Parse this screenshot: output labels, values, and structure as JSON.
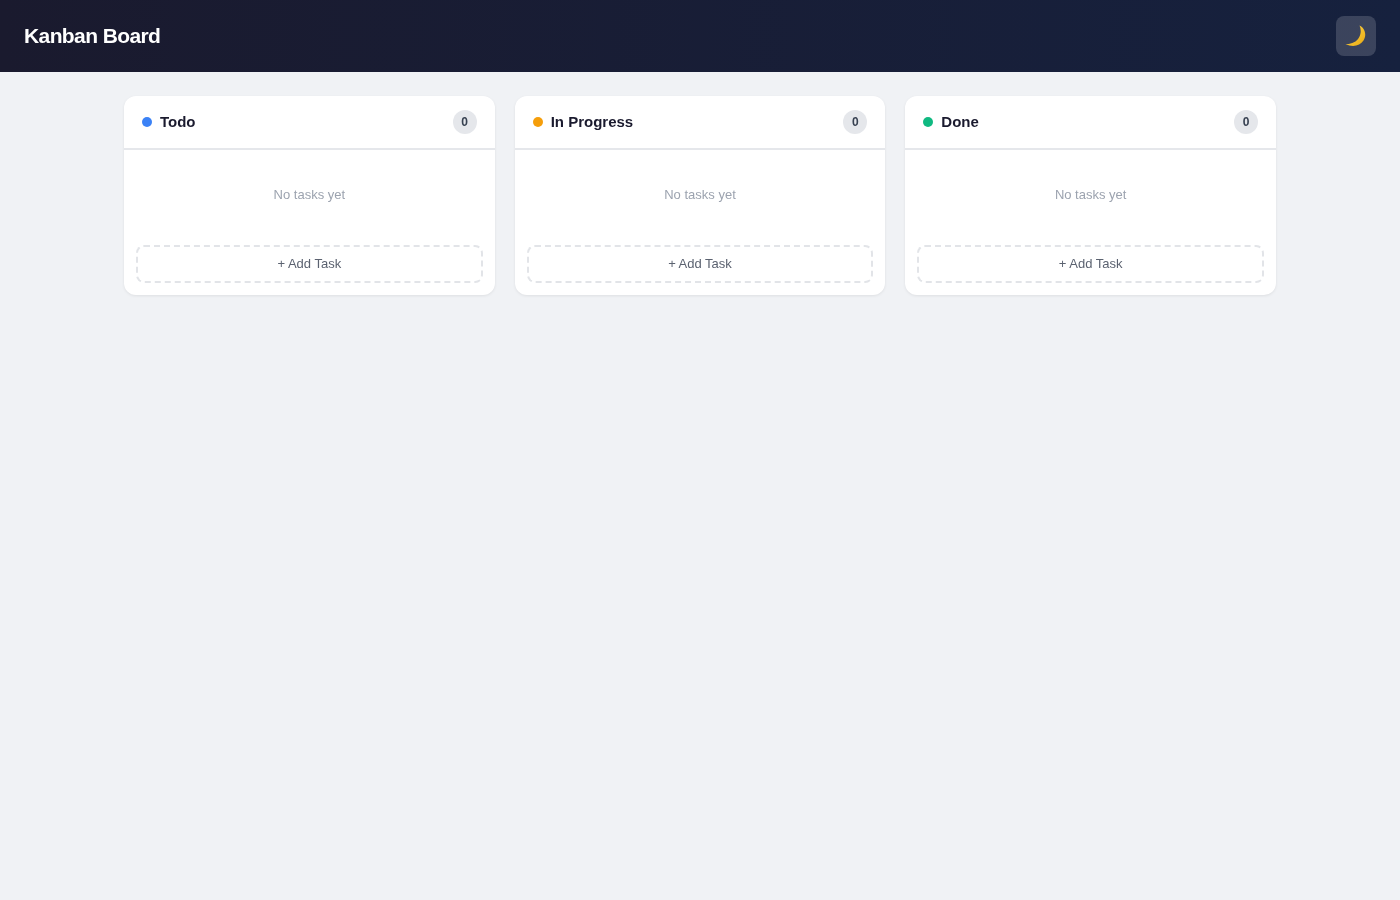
{
  "header": {
    "title": "Kanban Board"
  },
  "columns": [
    {
      "title": "Todo",
      "color": "#3b82f6",
      "count": "0",
      "empty_text": "No tasks yet",
      "add_label": "+ Add Task"
    },
    {
      "title": "In Progress",
      "color": "#f59e0b",
      "count": "0",
      "empty_text": "No tasks yet",
      "add_label": "+ Add Task"
    },
    {
      "title": "Done",
      "color": "#10b981",
      "count": "0",
      "empty_text": "No tasks yet",
      "add_label": "+ Add Task"
    }
  ]
}
